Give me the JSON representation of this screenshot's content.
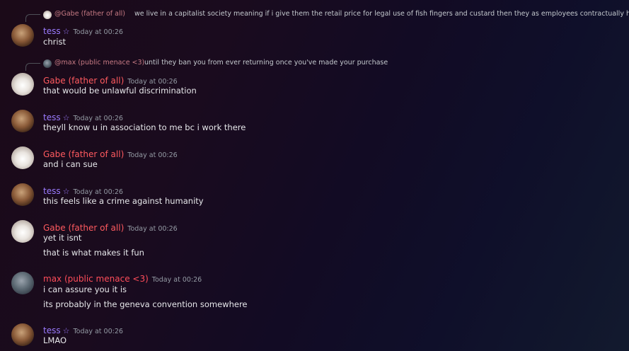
{
  "users": {
    "tess": {
      "name": "tess",
      "star": "☆",
      "color": "#9b7bff"
    },
    "gabe": {
      "name": "Gabe (father of all)",
      "color": "#ff5a5f"
    },
    "max": {
      "name": "max (public menace <3)",
      "color": "#ff4d5a"
    }
  },
  "messages": [
    {
      "reply": {
        "name": "@Gabe (father of all)",
        "text": "we live in a capitalist society meaning if i give them the retail price for legal use of fish fingers and custard then they as employees contractually hav"
      },
      "author": "tess",
      "time": "Today at 00:26",
      "lines": [
        "christ"
      ]
    },
    {
      "reply": {
        "name": "@max (public menace <3)",
        "text": "until they ban you from ever returning once you've made your purchase"
      },
      "author": "Gabe (father of all)",
      "time": "Today at 00:26",
      "lines": [
        "that would be unlawful discrimination"
      ]
    },
    {
      "author": "tess",
      "time": "Today at 00:26",
      "lines": [
        "theyll know u in association to me bc i work there"
      ]
    },
    {
      "author": "Gabe (father of all)",
      "time": "Today at 00:26",
      "lines": [
        "and i can sue"
      ]
    },
    {
      "author": "tess",
      "time": "Today at 00:26",
      "lines": [
        "this feels like a crime against humanity"
      ]
    },
    {
      "author": "Gabe (father of all)",
      "time": "Today at 00:26",
      "lines": [
        "yet it isnt",
        "that is what makes it fun"
      ]
    },
    {
      "author": "max (public menace <3)",
      "time": "Today at 00:26",
      "lines": [
        "i can assure you it is",
        "its probably in the geneva convention somewhere"
      ]
    },
    {
      "author": "tess",
      "time": "Today at 00:26",
      "lines": [
        "LMAO"
      ]
    }
  ]
}
